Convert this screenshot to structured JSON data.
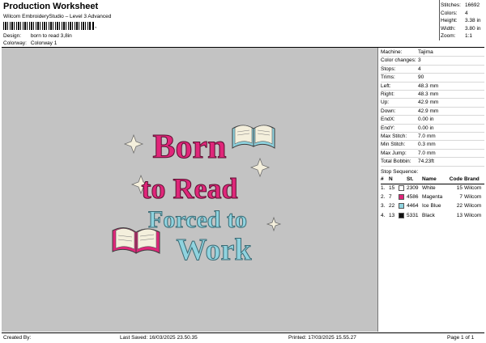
{
  "header": {
    "title": "Production Worksheet",
    "subtitle": "Wilcom EmbroideryStudio – Level 3 Advanced",
    "barcode_suffix": ","
  },
  "meta": [
    {
      "label": "Design:",
      "value": "born to read 3,8in"
    },
    {
      "label": "Colorway:",
      "value": "Colorway 1"
    }
  ],
  "stats": [
    {
      "label": "Stitches:",
      "value": "16692"
    },
    {
      "label": "Colors:",
      "value": "4"
    },
    {
      "label": "Height:",
      "value": "3.38 in"
    },
    {
      "label": "Width:",
      "value": "3.80 in"
    },
    {
      "label": "Zoom:",
      "value": "1:1"
    }
  ],
  "properties": [
    {
      "label": "Machine:",
      "value": "Tajima"
    },
    {
      "label": "Color changes:",
      "value": "3"
    },
    {
      "label": "Stops:",
      "value": "4"
    },
    {
      "label": "Trims:",
      "value": "90"
    },
    {
      "label": "Left:",
      "value": "48.3 mm"
    },
    {
      "label": "Right:",
      "value": "48.3 mm"
    },
    {
      "label": "Up:",
      "value": "42.9 mm"
    },
    {
      "label": "Down:",
      "value": "42.9 mm"
    },
    {
      "label": "EndX:",
      "value": "0.00 in"
    },
    {
      "label": "EndY:",
      "value": "0.00 in"
    },
    {
      "label": "Max Stitch:",
      "value": "7.0 mm"
    },
    {
      "label": "Min Stitch:",
      "value": "0.3 mm"
    },
    {
      "label": "Max Jump:",
      "value": "7.0 mm"
    },
    {
      "label": "Total Bobbin:",
      "value": "74.23ft"
    }
  ],
  "stop_sequence": {
    "title": "Stop Sequence:",
    "headers": [
      "#",
      "N",
      "St.",
      "Name",
      "Code",
      "Brand"
    ],
    "rows": [
      {
        "idx": "1.",
        "n": "15",
        "st": "2309",
        "name": "White",
        "code": "15",
        "brand": "Wilcom",
        "color": "#ffffff"
      },
      {
        "idx": "2.",
        "n": "7",
        "st": "4586",
        "name": "Magenta",
        "code": "7",
        "brand": "Wilcom",
        "color": "#e0267a"
      },
      {
        "idx": "3.",
        "n": "22",
        "st": "4464",
        "name": "Ice Blue",
        "code": "22",
        "brand": "Wilcom",
        "color": "#8fd3df"
      },
      {
        "idx": "4.",
        "n": "13",
        "st": "5331",
        "name": "Black",
        "code": "13",
        "brand": "Wilcom",
        "color": "#111111"
      }
    ]
  },
  "design_text": {
    "line1": "Born",
    "line2": "to Read",
    "line3": "Forced to",
    "line4": "Work"
  },
  "colors": {
    "magenta": "#e0267a",
    "ice_blue": "#8fd3df",
    "cream": "#f4efdc",
    "canvas": "#c3c3c3"
  },
  "footer": {
    "created_by": "Created By:",
    "last_saved": "Last Saved: 16/03/2025 23.50.35",
    "printed": "Printed: 17/03/2025 15.55.27",
    "page": "Page 1 of 1"
  }
}
